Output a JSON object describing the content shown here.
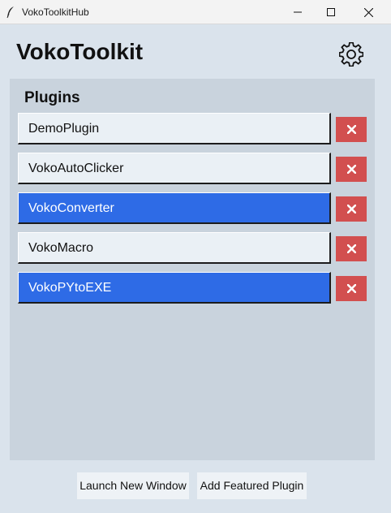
{
  "window": {
    "title": "VokoToolkitHub",
    "app_icon": "feather-icon",
    "controls": [
      "minimize-icon",
      "maximize-icon",
      "close-icon"
    ]
  },
  "header": {
    "title": "VokoToolkit",
    "settings_icon": "gear-icon"
  },
  "plugins_panel": {
    "title": "Plugins",
    "items": [
      {
        "label": "DemoPlugin",
        "selected": false
      },
      {
        "label": "VokoAutoClicker",
        "selected": false
      },
      {
        "label": "VokoConverter",
        "selected": true
      },
      {
        "label": "VokoMacro",
        "selected": false
      },
      {
        "label": "VokoPYtoEXE",
        "selected": true
      }
    ],
    "remove_icon": "x-mark-icon"
  },
  "footer": {
    "launch_label": "Launch New Window",
    "add_label": "Add Featured Plugin"
  },
  "colors": {
    "background": "#dae3ec",
    "panel": "#c9d3dd",
    "selected": "#2e6be6",
    "remove": "#d24f4f",
    "button": "#eaf0f5"
  }
}
